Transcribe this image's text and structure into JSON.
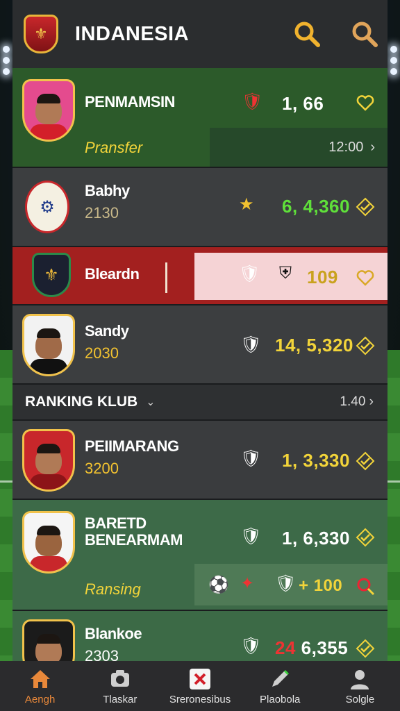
{
  "header": {
    "title": "INDANESIA"
  },
  "rows": [
    {
      "name": "PENMAMSIN",
      "sub": "Pransfer",
      "score": "1, 66",
      "time": "12:00"
    },
    {
      "name": "Babhy",
      "sub": "2130",
      "score": "6, 4,360"
    },
    {
      "name": "Bleardn",
      "score": "109"
    },
    {
      "name": "Sandy",
      "sub": "2030",
      "score": "14, 5,320"
    }
  ],
  "section": {
    "title": "RANKING KLUB",
    "right": "1.40"
  },
  "rows2": [
    {
      "name": "PEIIMARANG",
      "sub": "3200",
      "score": "1, 3,330"
    },
    {
      "name_line1": "BARETD",
      "name_line2": "BENEARMAM",
      "sub": "Ransing",
      "score": "1, 6,330",
      "extra_score": "100"
    },
    {
      "name": "Blankoe",
      "sub": "2303",
      "score_a": "24",
      "score_b": "6,355"
    }
  ],
  "nav": [
    {
      "label": "Aengh",
      "icon": "home-icon"
    },
    {
      "label": "Tlaskar",
      "icon": "camera-icon"
    },
    {
      "label": "Sreronesibus",
      "icon": "close-icon"
    },
    {
      "label": "Plaobola",
      "icon": "pencil-icon"
    },
    {
      "label": "Solgle",
      "icon": "user-icon"
    }
  ],
  "colors": {
    "accent": "#e8b53a",
    "green_row": "#2c5a2a",
    "red_row": "#a3201f",
    "yellow": "#f2d43a",
    "green_text": "#5fe03a"
  }
}
